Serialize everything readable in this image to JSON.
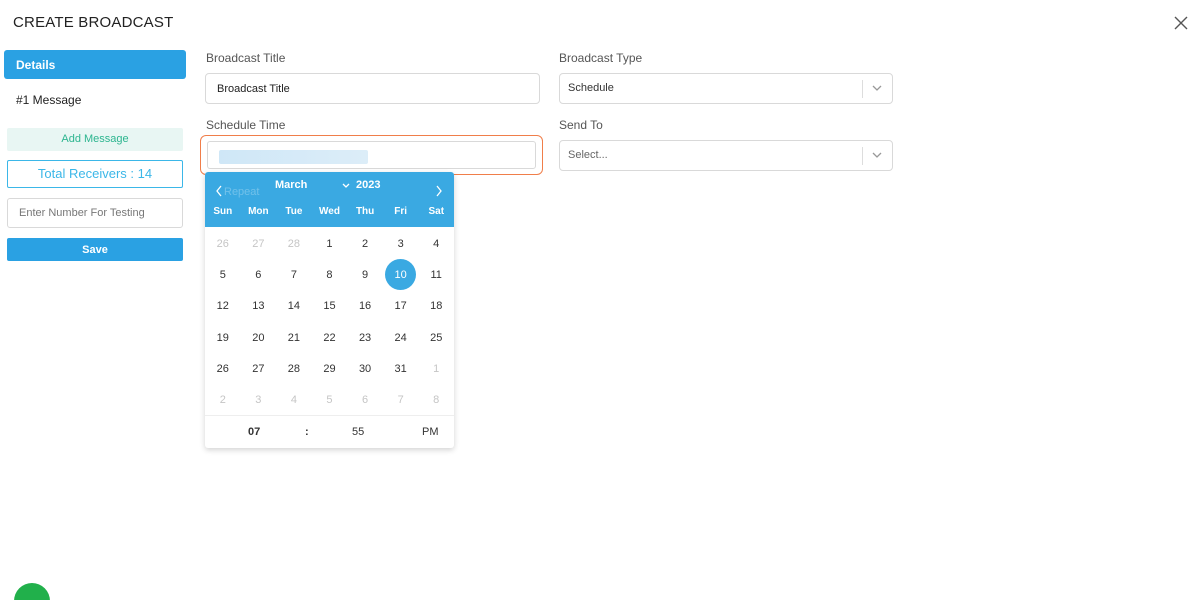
{
  "modal": {
    "title": "CREATE BROADCAST"
  },
  "sidebar": {
    "details_label": "Details",
    "message_label": "#1 Message",
    "add_message_label": "Add Message",
    "total_receivers": "Total Receivers : 14",
    "test_number_placeholder": "Enter Number For Testing",
    "save_label": "Save"
  },
  "form": {
    "broadcast_title": {
      "label": "Broadcast Title",
      "value": "Broadcast Title"
    },
    "broadcast_type": {
      "label": "Broadcast Type",
      "value": "Schedule"
    },
    "schedule_time": {
      "label": "Schedule Time"
    },
    "send_to": {
      "label": "Send To",
      "placeholder": "Select..."
    }
  },
  "calendar": {
    "month": "March",
    "year": "2023",
    "ghost_text": "Repeat",
    "weekdays": [
      "Sun",
      "Mon",
      "Tue",
      "Wed",
      "Thu",
      "Fri",
      "Sat"
    ],
    "days": [
      {
        "d": "26",
        "muted": true
      },
      {
        "d": "27",
        "muted": true
      },
      {
        "d": "28",
        "muted": true
      },
      {
        "d": "1"
      },
      {
        "d": "2"
      },
      {
        "d": "3"
      },
      {
        "d": "4"
      },
      {
        "d": "5"
      },
      {
        "d": "6"
      },
      {
        "d": "7"
      },
      {
        "d": "8"
      },
      {
        "d": "9"
      },
      {
        "d": "10",
        "selected": true
      },
      {
        "d": "11"
      },
      {
        "d": "12"
      },
      {
        "d": "13"
      },
      {
        "d": "14"
      },
      {
        "d": "15"
      },
      {
        "d": "16"
      },
      {
        "d": "17"
      },
      {
        "d": "18"
      },
      {
        "d": "19"
      },
      {
        "d": "20"
      },
      {
        "d": "21"
      },
      {
        "d": "22"
      },
      {
        "d": "23"
      },
      {
        "d": "24"
      },
      {
        "d": "25"
      },
      {
        "d": "26"
      },
      {
        "d": "27"
      },
      {
        "d": "28"
      },
      {
        "d": "29"
      },
      {
        "d": "30"
      },
      {
        "d": "31"
      },
      {
        "d": "1",
        "muted": true
      },
      {
        "d": "2",
        "muted": true
      },
      {
        "d": "3",
        "muted": true
      },
      {
        "d": "4",
        "muted": true
      },
      {
        "d": "5",
        "muted": true
      },
      {
        "d": "6",
        "muted": true
      },
      {
        "d": "7",
        "muted": true
      },
      {
        "d": "8",
        "muted": true
      }
    ],
    "time": {
      "hour": "07",
      "separator": ":",
      "minute": "55",
      "ampm": "PM"
    }
  },
  "icons": {
    "close": "close-icon",
    "chevron": "chevron-down-icon",
    "prev": "chevron-left-icon",
    "next": "chevron-right-icon",
    "chat": "chat-widget-icon"
  },
  "colors": {
    "primary": "#2aa1e3",
    "calendar_header": "#3aa9e2",
    "focus_outline": "#f07e4a",
    "add_message_text": "#2cb58f",
    "chat_fab": "#21b04b"
  }
}
